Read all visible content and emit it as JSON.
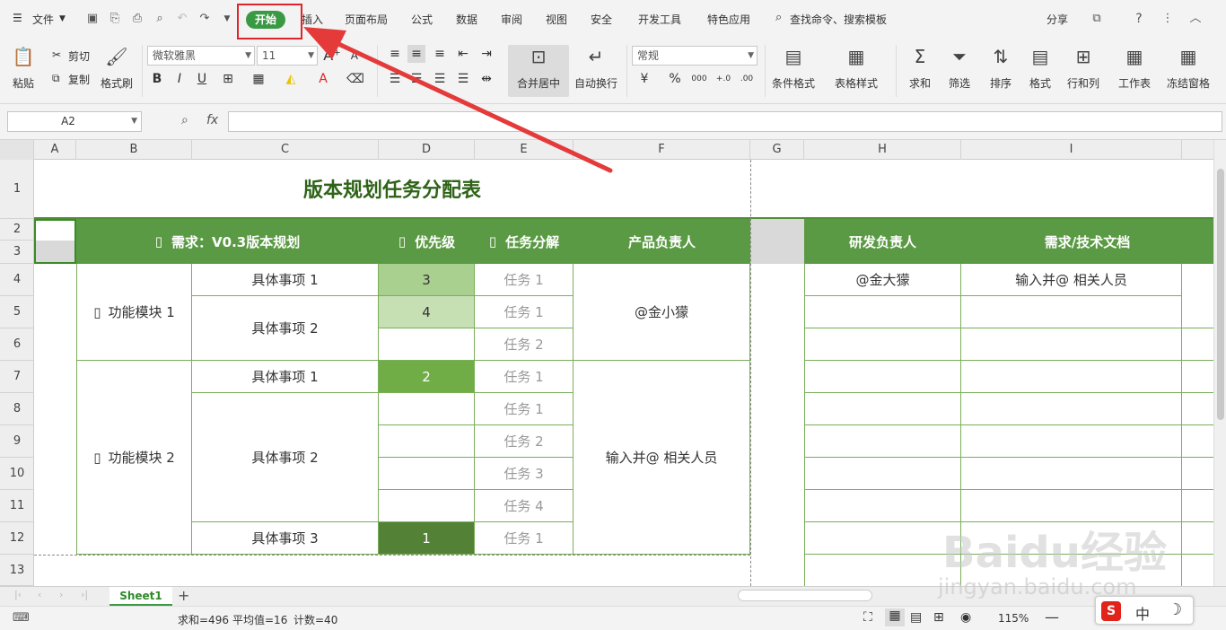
{
  "menu": {
    "file": "文件",
    "tabs": [
      "开始",
      "插入",
      "页面布局",
      "公式",
      "数据",
      "审阅",
      "视图",
      "安全",
      "开发工具",
      "特色应用"
    ],
    "search": "查找命令、搜索模板",
    "share": "分享",
    "help": "?"
  },
  "toolbar": {
    "paste": "粘贴",
    "cut": "剪切",
    "copy": "复制",
    "format_painter": "格式刷",
    "font_name": "微软雅黑",
    "font_size": "11",
    "merge_center": "合并居中",
    "wrap_text": "自动换行",
    "number_format": "常规",
    "conditional_format": "条件格式",
    "table_style": "表格样式",
    "sum": "求和",
    "filter": "筛选",
    "sort": "排序",
    "format": "格式",
    "row_col": "行和列",
    "worksheet": "工作表",
    "freeze": "冻结窗格",
    "percent": "%",
    "thousands": "000"
  },
  "formula_bar": {
    "name_box": "A2",
    "fx": "fx"
  },
  "columns": [
    "A",
    "B",
    "C",
    "D",
    "E",
    "F",
    "G",
    "H",
    "I"
  ],
  "rows": [
    "1",
    "2",
    "3",
    "4",
    "5",
    "6",
    "7",
    "8",
    "9",
    "10",
    "11",
    "12",
    "13"
  ],
  "sheet": {
    "title": "版本规划任务分配表",
    "header": {
      "requirement": "需求：V0.3版本规划",
      "priority": "优先级",
      "task": "任务分解",
      "product_owner": "产品负责人",
      "dev_owner": "研发负责人",
      "docs": "需求/技术文档"
    },
    "module1": "功能模块 1",
    "module2": "功能模块 2",
    "items": [
      "具体事项 1",
      "具体事项 2",
      "具体事项 1",
      "具体事项 2",
      "具体事项 3"
    ],
    "priorities": [
      "3",
      "4",
      "2",
      "1"
    ],
    "tasks": [
      "任务 1",
      "任务 1",
      "任务 2",
      "任务 1",
      "任务 1",
      "任务 2",
      "任务 3",
      "任务 4",
      "任务 1"
    ],
    "owner1": "@金小獴",
    "owner2": "输入并@ 相关人员",
    "dev1": "@金大獴",
    "doc1": "输入并@ 相关人员"
  },
  "sheet_tabs": [
    "Sheet1"
  ],
  "status": {
    "sum": "求和=496",
    "avg": "平均值=16",
    "count": "计数=40",
    "zoom": "115%"
  },
  "ime": {
    "lang": "中"
  },
  "watermark": {
    "brand": "Baidu经验",
    "url": "jingyan.baidu.com"
  }
}
